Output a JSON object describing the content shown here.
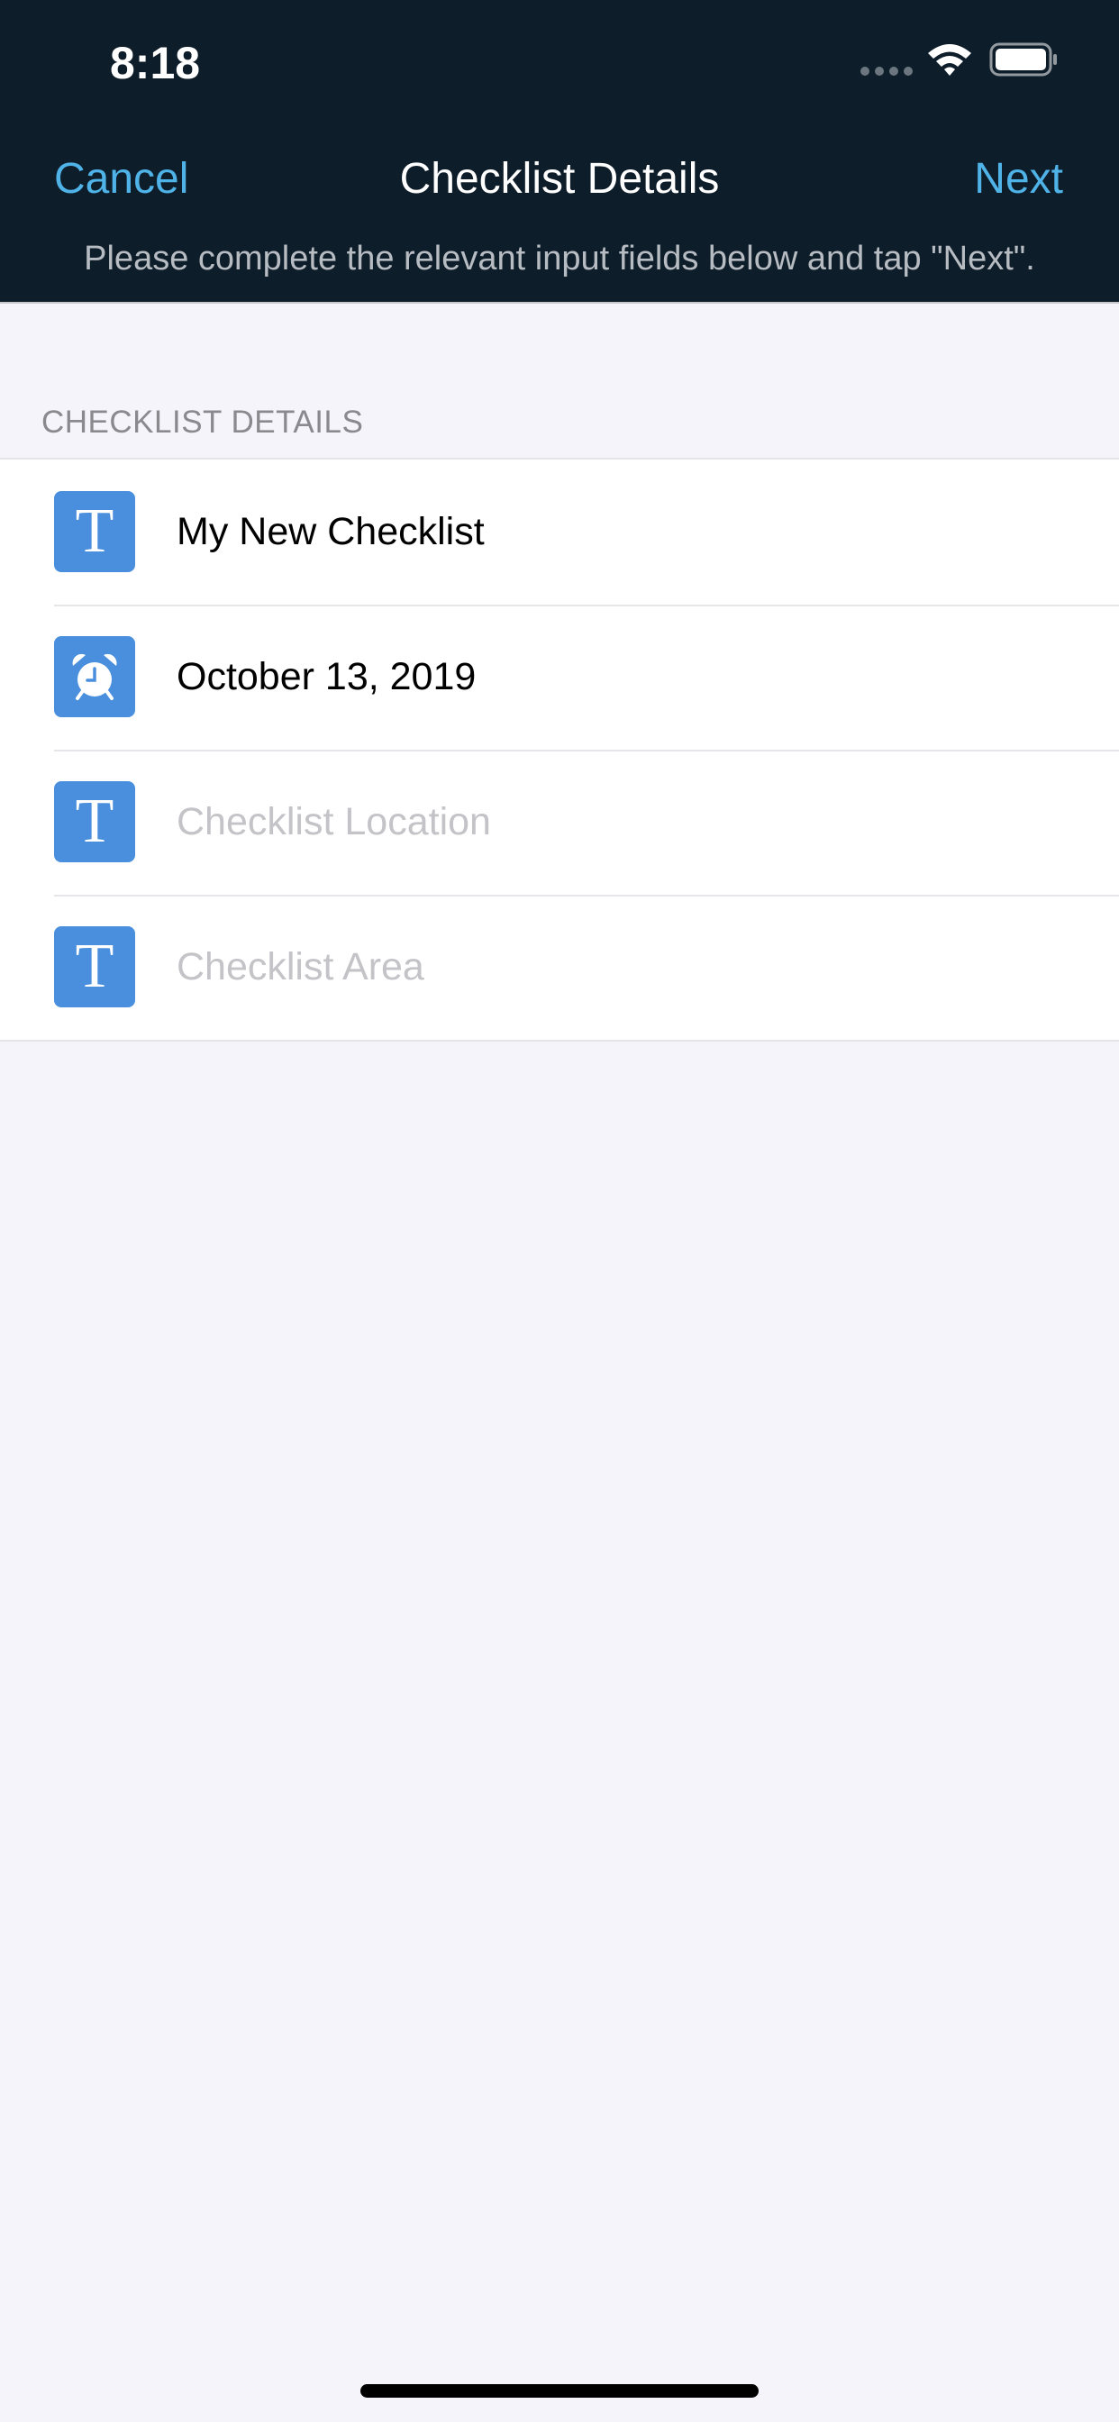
{
  "status_bar": {
    "time": "8:18",
    "icons": [
      "cellular-signal-icon",
      "wifi-icon",
      "battery-icon"
    ]
  },
  "nav": {
    "cancel_label": "Cancel",
    "title": "Checklist Details",
    "next_label": "Next",
    "subtitle": "Please complete the relevant input fields below and tap \"Next\"."
  },
  "section": {
    "header": "CHECKLIST DETAILS"
  },
  "fields": {
    "name": {
      "icon": "text-field-icon",
      "icon_glyph": "T",
      "value": "My New Checklist"
    },
    "date": {
      "icon": "alarm-clock-icon",
      "value": "October 13, 2019"
    },
    "location": {
      "icon": "text-field-icon",
      "icon_glyph": "T",
      "value": "",
      "placeholder": "Checklist Location"
    },
    "area": {
      "icon": "text-field-icon",
      "icon_glyph": "T",
      "value": "",
      "placeholder": "Checklist Area"
    }
  },
  "colors": {
    "header_background": "#0e1d2a",
    "accent": "#4fb3e8",
    "icon_background": "#4a8fde",
    "page_background": "#f4f4fa",
    "placeholder": "#c4c4c8"
  }
}
